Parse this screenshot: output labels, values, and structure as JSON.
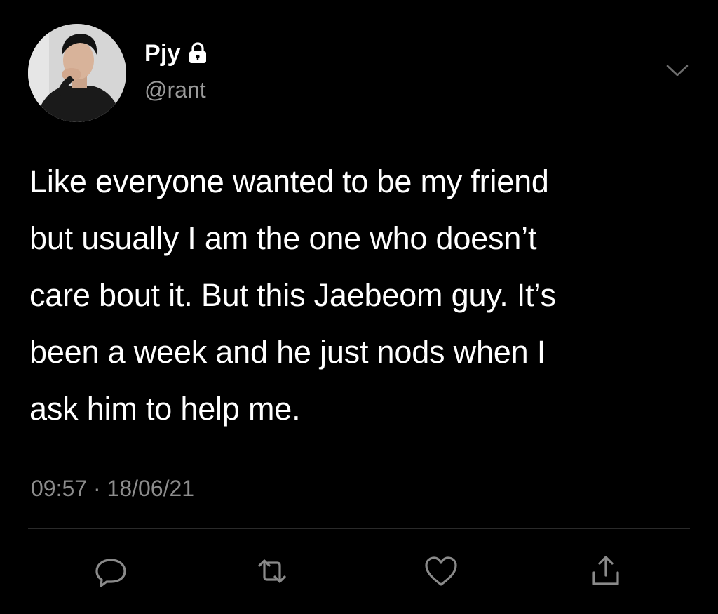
{
  "tweet": {
    "display_name": "Pjy",
    "handle": "@rant",
    "body": "Like everyone wanted to be my friend\nbut usually I am the one who doesn’t\ncare bout it. But this Jaebeom guy. It’s\nbeen a week and he just nods when I\nask him to help me.",
    "time": "09:57",
    "separator": "·",
    "date": "18/06/21"
  },
  "icons": {
    "lock": "lock-icon",
    "menu": "chevron-down-icon",
    "reply": "reply-icon",
    "retweet": "retweet-icon",
    "like": "heart-icon",
    "share": "share-icon"
  },
  "colors": {
    "background": "#000000",
    "text_primary": "#ffffff",
    "text_secondary": "#8d8d8d",
    "icon": "#8a8a8a",
    "divider": "#2a2a2a"
  }
}
